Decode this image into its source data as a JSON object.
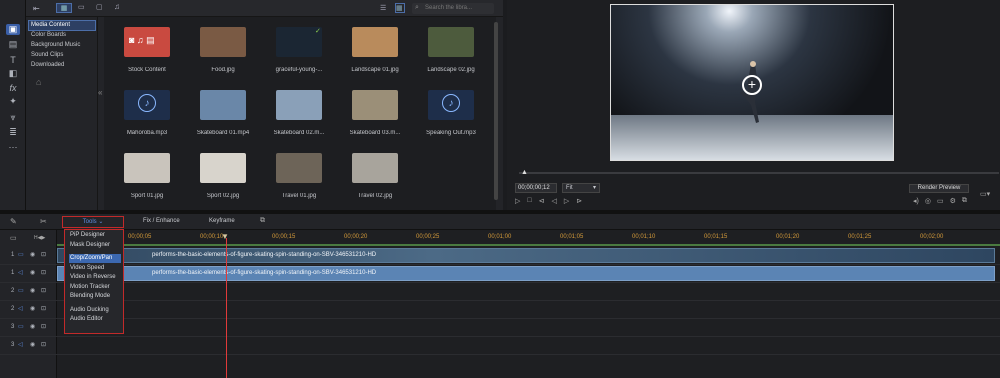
{
  "library": {
    "search_placeholder": "Search the libra...",
    "categories": [
      "Media Content",
      "Color Boards",
      "Background Music",
      "Sound Clips",
      "Downloaded"
    ],
    "items": [
      {
        "label": "Stock Content",
        "color": "#c94a40"
      },
      {
        "label": "Food.jpg",
        "color": "#7a5a44"
      },
      {
        "label": "graceful-young-...",
        "color": "#1b2633"
      },
      {
        "label": "Landscape 01.jpg",
        "color": "#b98b5c"
      },
      {
        "label": "Landscape 02.jpg",
        "color": "#4d5b3d"
      },
      {
        "label": "Mahoroba.mp3",
        "color": "#1e2e4a"
      },
      {
        "label": "Skateboard 01.mp4",
        "color": "#6a87a8"
      },
      {
        "label": "Skateboard 02.m...",
        "color": "#8aa0b8"
      },
      {
        "label": "Skateboard 03.m...",
        "color": "#9b8f78"
      },
      {
        "label": "Speaking Out.mp3",
        "color": "#1e2e4a"
      },
      {
        "label": "Sport 01.jpg",
        "color": "#c9c4bc"
      },
      {
        "label": "Sport 02.jpg",
        "color": "#d8d4cc"
      },
      {
        "label": "Travel 01.jpg",
        "color": "#6d6458"
      },
      {
        "label": "Travel 02.jpg",
        "color": "#a8a49c"
      }
    ]
  },
  "preview": {
    "timecode": "00;00;00;12",
    "fit": "Fit",
    "render_label": "Render Preview"
  },
  "timeline_toolbar": {
    "tools": "Tools",
    "fix_enhance": "Fix / Enhance",
    "keyframe": "Keyframe"
  },
  "tools_menu": [
    "PiP Designer",
    "Mask Designer",
    "Crop/Zoom/Pan",
    "Video Speed",
    "Video in Reverse",
    "Motion Tracker",
    "Blending Mode",
    "Audio Ducking",
    "Audio Editor"
  ],
  "ruler": [
    "00;00;05",
    "00;00;10",
    "00;00;15",
    "00;00;20",
    "00;00;25",
    "00;01;00",
    "00;01;05",
    "00;01;10",
    "00;01;15",
    "00;01;20",
    "00;01;25",
    "00;02;00"
  ],
  "tracks": [
    "1",
    "1",
    "2",
    "2",
    "3",
    "3"
  ],
  "clip_name": "performs-the-basic-elements-of-figure-skating-spin-standing-on-SBV-346531210-HD",
  "accent": "#3c68b0",
  "highlight": "#c22a2a"
}
